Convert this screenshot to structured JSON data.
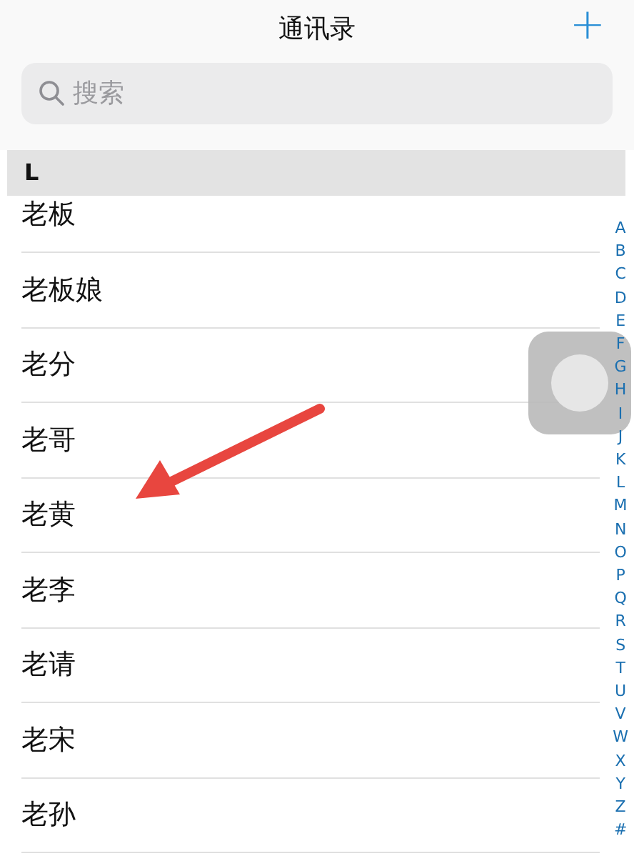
{
  "nav_bar": {
    "title": "通讯录",
    "add_button": "+"
  },
  "search": {
    "placeholder": "搜索"
  },
  "section": {
    "header": "L",
    "contacts": [
      "老板",
      "老板娘",
      "老分",
      "老哥",
      "老黄",
      "老李",
      "老请",
      "老宋",
      "老孙"
    ]
  },
  "index": [
    "A",
    "B",
    "C",
    "D",
    "E",
    "F",
    "G",
    "H",
    "I",
    "J",
    "K",
    "L",
    "M",
    "N",
    "O",
    "P",
    "Q",
    "R",
    "S",
    "T",
    "U",
    "V",
    "W",
    "X",
    "Y",
    "Z",
    "#"
  ]
}
